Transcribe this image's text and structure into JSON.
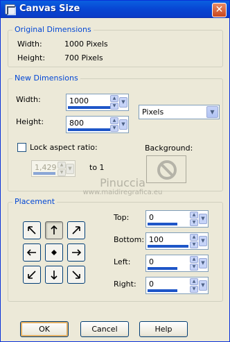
{
  "window": {
    "title": "Canvas Size",
    "close_glyph": "✕"
  },
  "original": {
    "title": "Original Dimensions",
    "width_label": "Width:",
    "width_value": "1000 Pixels",
    "height_label": "Height:",
    "height_value": "700 Pixels"
  },
  "new_dims": {
    "title": "New Dimensions",
    "width_label": "Width:",
    "width_value": "1000",
    "width_level": 0.75,
    "height_label": "Height:",
    "height_value": "800",
    "height_level": 0.72,
    "units": "Pixels",
    "lock_label": "Lock aspect ratio:",
    "lock_checked": false,
    "ratio_value": "1,429",
    "ratio_level": 0.55,
    "ratio_suffix": "to 1",
    "background_label": "Background:"
  },
  "watermark": {
    "name": "Pinuccia",
    "site": "www.maidiregrafica.eu"
  },
  "placement": {
    "title": "Placement",
    "selected": "top-center",
    "top_label": "Top:",
    "top_value": "0",
    "top_level": 0.5,
    "bottom_label": "Bottom:",
    "bottom_value": "100",
    "bottom_level": 0.7,
    "left_label": "Left:",
    "left_value": "0",
    "left_level": 0.5,
    "right_label": "Right:",
    "right_value": "0",
    "right_level": 0.5
  },
  "buttons": {
    "ok": "OK",
    "cancel": "Cancel",
    "help": "Help"
  },
  "icons": {
    "spin_up": "▲",
    "spin_down": "▼",
    "dropdown": "▼",
    "background": "no-sign-icon"
  },
  "colors": {
    "titlebar": "#0a5fe0",
    "group_title": "#0046d5",
    "progress": "#1e56c8",
    "dialog": "#ece9d8"
  }
}
